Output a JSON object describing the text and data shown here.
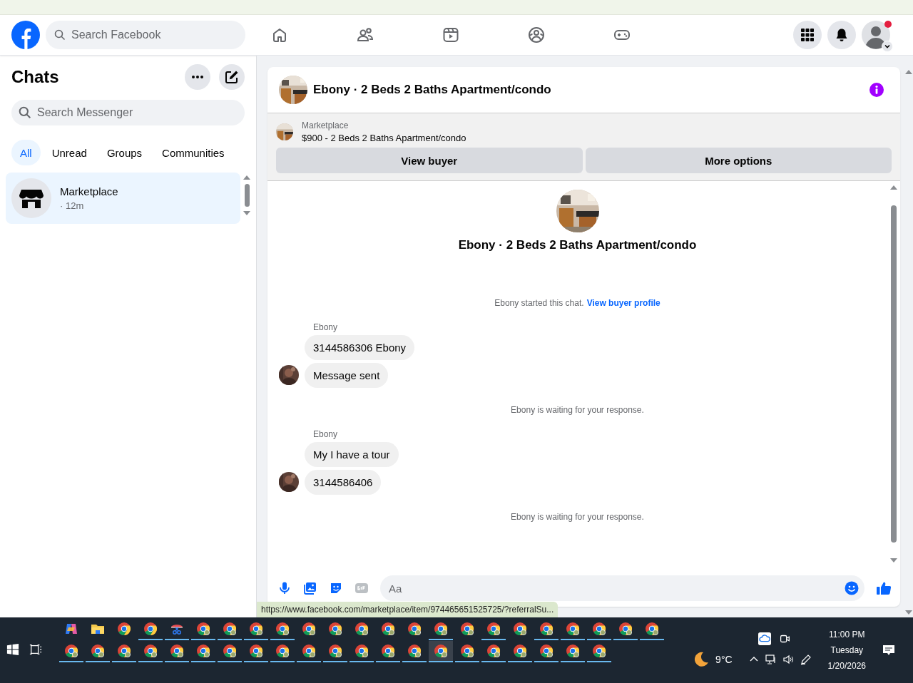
{
  "header": {
    "search": {
      "placeholder": "Search Facebook"
    }
  },
  "sidebar": {
    "title": "Chats",
    "search": {
      "placeholder": "Search Messenger"
    },
    "filters": [
      {
        "label": "All",
        "selected": true
      },
      {
        "label": "Unread",
        "selected": false
      },
      {
        "label": "Groups",
        "selected": false
      },
      {
        "label": "Communities",
        "selected": false
      }
    ],
    "chats": [
      {
        "name": "Marketplace",
        "time": "· 12m",
        "selected": true
      }
    ]
  },
  "conversation": {
    "title": "Ebony · 2 Beds 2 Baths Apartment/condo",
    "listing": {
      "label": "Marketplace",
      "title": "$900 - 2 Beds 2 Baths Apartment/condo"
    },
    "buttons": [
      "View buyer",
      "More options"
    ],
    "intro_title": "Ebony · 2 Beds 2 Baths Apartment/condo",
    "events": [
      {
        "kind": "notice",
        "text": "Ebony started this chat.",
        "link": "View buyer profile"
      },
      {
        "kind": "group",
        "sender": "Ebony",
        "messages": [
          "3144586306 Ebony",
          "Message sent"
        ]
      },
      {
        "kind": "notice",
        "text": "Ebony is waiting for your response."
      },
      {
        "kind": "group",
        "sender": "Ebony",
        "messages": [
          "My I have a tour",
          "3144586406"
        ]
      },
      {
        "kind": "notice",
        "text": "Ebony is waiting for your response."
      }
    ],
    "composer": {
      "placeholder": "Aa"
    }
  },
  "status_url": "https://www.facebook.com/marketplace/item/974465651525725/?referralSu...",
  "taskbar": {
    "row_1": [
      {
        "kind": "copilot",
        "running": false
      },
      {
        "kind": "folder",
        "running": false
      },
      {
        "kind": "chrome",
        "running": false
      },
      {
        "kind": "chrome",
        "running": true
      },
      {
        "kind": "snip",
        "running": true
      },
      {
        "kind": "profile",
        "running": true
      },
      {
        "kind": "profile",
        "running": true
      },
      {
        "kind": "profile",
        "running": true
      },
      {
        "kind": "profile",
        "running": true
      },
      {
        "kind": "profile",
        "running": false
      },
      {
        "kind": "profile",
        "running": false
      },
      {
        "kind": "profile",
        "running": false
      },
      {
        "kind": "profile",
        "running": false
      },
      {
        "kind": "profile",
        "running": false
      },
      {
        "kind": "profile",
        "running": true
      },
      {
        "kind": "profile",
        "running": false
      },
      {
        "kind": "profile",
        "running": true
      },
      {
        "kind": "profile",
        "running": false
      },
      {
        "kind": "profile",
        "running": true
      },
      {
        "kind": "profile",
        "running": true
      },
      {
        "kind": "profile",
        "running": true
      },
      {
        "kind": "profile",
        "running": true
      },
      {
        "kind": "profile",
        "running": true
      }
    ],
    "row_2": [
      {
        "kind": "profile",
        "running": true,
        "selected": false
      },
      {
        "kind": "profile",
        "running": true,
        "selected": false
      },
      {
        "kind": "profile",
        "running": true,
        "selected": false
      },
      {
        "kind": "profile",
        "running": true,
        "selected": false
      },
      {
        "kind": "profile",
        "running": true,
        "selected": false
      },
      {
        "kind": "profile",
        "running": true,
        "selected": false
      },
      {
        "kind": "profile",
        "running": true,
        "selected": false
      },
      {
        "kind": "profile",
        "running": true,
        "selected": false
      },
      {
        "kind": "profile",
        "running": true,
        "selected": false
      },
      {
        "kind": "profile",
        "running": true,
        "selected": false
      },
      {
        "kind": "profile",
        "running": true,
        "selected": false
      },
      {
        "kind": "profile",
        "running": true,
        "selected": false
      },
      {
        "kind": "profile",
        "running": true,
        "selected": false
      },
      {
        "kind": "profile",
        "running": true,
        "selected": false
      },
      {
        "kind": "profile",
        "running": true,
        "selected": true
      },
      {
        "kind": "profile",
        "running": true,
        "selected": false
      },
      {
        "kind": "profile",
        "running": true,
        "selected": false
      },
      {
        "kind": "profile",
        "running": true,
        "selected": false
      },
      {
        "kind": "profile",
        "running": true,
        "selected": false
      },
      {
        "kind": "profile",
        "running": true,
        "selected": false
      },
      {
        "kind": "profile",
        "running": true,
        "selected": false
      }
    ],
    "temperature": "9°C",
    "time": "11:00 PM",
    "day": "Tuesday",
    "date": "1/20/2026"
  }
}
